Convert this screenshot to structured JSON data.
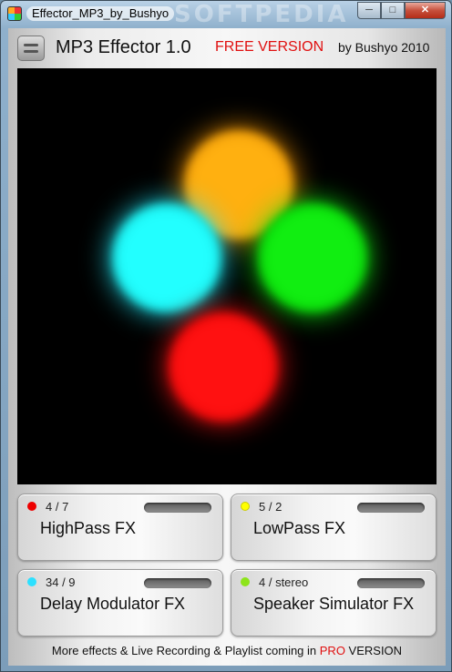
{
  "window": {
    "title": "Effector_MP3_by_Bushyo",
    "watermark": "SOFTPEDIA"
  },
  "header": {
    "app_name": "MP3 Effector  1.0",
    "edition": "FREE VERSION",
    "author": "by Bushyo 2010"
  },
  "colors": {
    "orange": "#ffb010",
    "cyan": "#22ffff",
    "green": "#11ee11",
    "red": "#ff1111"
  },
  "effects": [
    {
      "label": "HighPass FX",
      "value": "4 / 7",
      "color": "red"
    },
    {
      "label": "LowPass FX",
      "value": "5 / 2",
      "color": "yellow"
    },
    {
      "label": "Delay Modulator FX",
      "value": "34 / 9",
      "color": "cyan"
    },
    {
      "label": "Speaker Simulator FX",
      "value": "4 / stereo",
      "color": "lime"
    }
  ],
  "footer": {
    "text_before": "More effects & Live Recording & Playlist coming in ",
    "pro": "PRO",
    "text_after": " VERSION"
  }
}
